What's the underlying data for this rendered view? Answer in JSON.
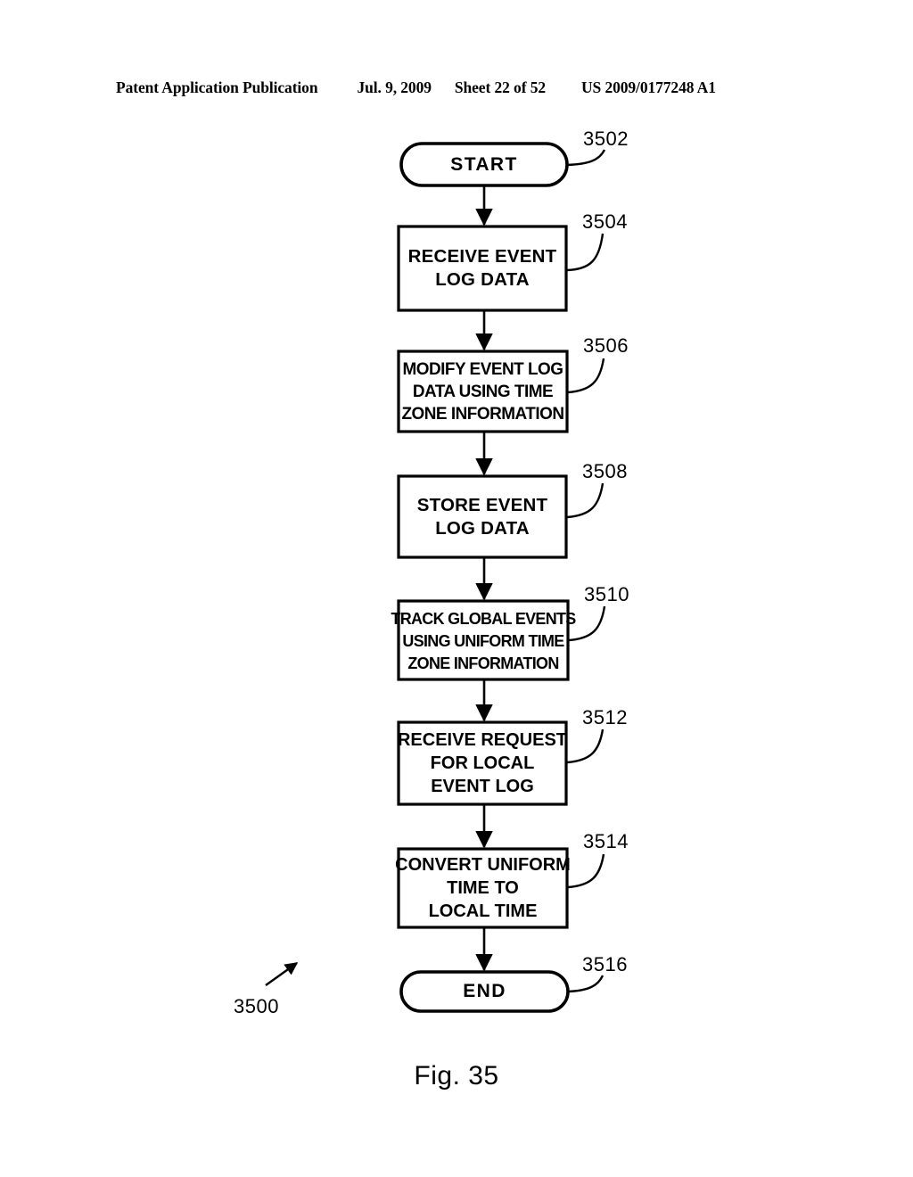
{
  "header": {
    "publication": "Patent Application Publication",
    "date": "Jul. 9, 2009",
    "sheet": "Sheet 22 of 52",
    "patent_number": "US 2009/0177248 A1"
  },
  "figure": {
    "caption": "Fig. 35",
    "diagram_ref": "3500"
  },
  "flowchart": {
    "nodes": [
      {
        "id": "start",
        "shape": "terminal",
        "ref": "3502",
        "lines": [
          "START"
        ]
      },
      {
        "id": "receive-event-log-data",
        "shape": "process",
        "ref": "3504",
        "lines": [
          "RECEIVE EVENT",
          "LOG DATA"
        ]
      },
      {
        "id": "modify-event-log-data",
        "shape": "process",
        "ref": "3506",
        "lines": [
          "MODIFY EVENT LOG",
          "DATA USING TIME",
          "ZONE INFORMATION"
        ]
      },
      {
        "id": "store-event-log-data",
        "shape": "process",
        "ref": "3508",
        "lines": [
          "STORE EVENT",
          "LOG DATA"
        ]
      },
      {
        "id": "track-global-events",
        "shape": "process",
        "ref": "3510",
        "lines": [
          "TRACK GLOBAL EVENTS",
          "USING UNIFORM TIME",
          "ZONE INFORMATION"
        ]
      },
      {
        "id": "receive-request-local-event-log",
        "shape": "process",
        "ref": "3512",
        "lines": [
          "RECEIVE REQUEST",
          "FOR LOCAL",
          "EVENT LOG"
        ]
      },
      {
        "id": "convert-uniform-time",
        "shape": "process",
        "ref": "3514",
        "lines": [
          "CONVERT UNIFORM",
          "TIME TO",
          "LOCAL TIME"
        ]
      },
      {
        "id": "end",
        "shape": "terminal",
        "ref": "3516",
        "lines": [
          "END"
        ]
      }
    ]
  },
  "colors": {
    "ink": "#000000",
    "page": "#ffffff"
  }
}
